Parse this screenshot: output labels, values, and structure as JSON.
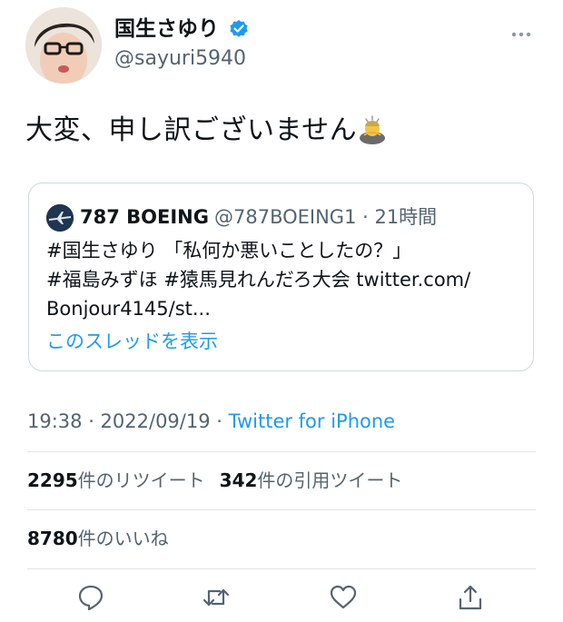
{
  "author": {
    "display_name": "国生さゆり",
    "handle": "@sayuri5940",
    "verified": true
  },
  "tweet": {
    "text": "大変、申し訳ございません",
    "emoji": "person-bowing-emoji"
  },
  "quote": {
    "author_name": "787 BOEING",
    "author_meta": "@787BOEING1 · 21時間",
    "lines": [
      "#国生さゆり 「私何か悪いことしたの？」",
      "#福島みずほ #猿馬見れんだろ大会 twitter.com/",
      "Bonjour4145/st..."
    ],
    "show_thread": "このスレッドを表示"
  },
  "timestamp": {
    "time_date": "19:38 · 2022/09/19 · ",
    "source": "Twitter for iPhone"
  },
  "stats": {
    "retweets_count": "2295",
    "retweets_label": "件のリツイート",
    "quotes_count": "342",
    "quotes_label": "件の引用ツイート",
    "likes_count": "8780",
    "likes_label": "件のいいね"
  },
  "icons": {
    "more": "more-icon",
    "reply": "reply-icon",
    "retweet": "retweet-icon",
    "like": "like-icon",
    "share": "share-icon"
  },
  "colors": {
    "accent": "#1d9bf0",
    "secondary_text": "#536471",
    "primary_text": "#0f1419",
    "border": "#cfd9de"
  }
}
